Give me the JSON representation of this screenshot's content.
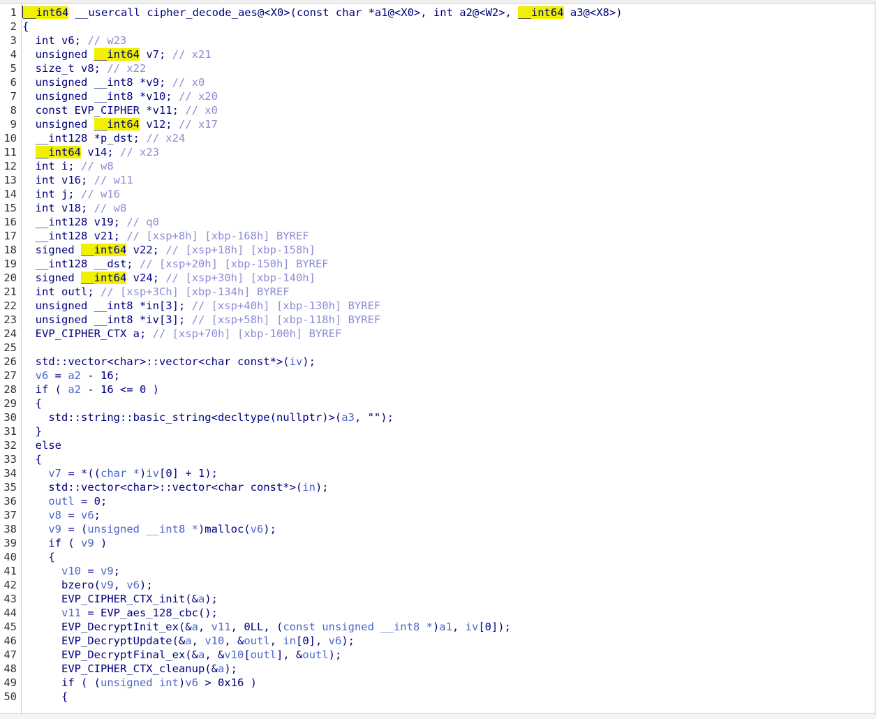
{
  "app": {
    "view": "pseudocode",
    "highlight_color": "#f0f000",
    "highlight_token": "__int64"
  },
  "colors": {
    "type": "#000080",
    "variable": "#4a66cc",
    "comment": "#8c8cd6",
    "line_number": "#333333"
  },
  "lines": [
    {
      "n": "1",
      "t": [
        [
          "hl",
          "__int64"
        ],
        [
          "t",
          " __usercall cipher_decode_aes@<X0>(const char *a1@<X0>, int a2@<W2>, "
        ],
        [
          "hl",
          "__int64"
        ],
        [
          "t",
          " a3@<X8>)"
        ]
      ]
    },
    {
      "n": "2",
      "t": [
        [
          "t",
          "{"
        ]
      ]
    },
    {
      "n": "3",
      "t": [
        [
          "t",
          "  int v6; "
        ],
        [
          "c",
          "// w23"
        ]
      ]
    },
    {
      "n": "4",
      "t": [
        [
          "t",
          "  unsigned "
        ],
        [
          "hl",
          "__int64"
        ],
        [
          "t",
          " v7; "
        ],
        [
          "c",
          "// x21"
        ]
      ]
    },
    {
      "n": "5",
      "t": [
        [
          "t",
          "  size_t v8; "
        ],
        [
          "c",
          "// x22"
        ]
      ]
    },
    {
      "n": "6",
      "t": [
        [
          "t",
          "  unsigned __int8 *v9; "
        ],
        [
          "c",
          "// x0"
        ]
      ]
    },
    {
      "n": "7",
      "t": [
        [
          "t",
          "  unsigned __int8 *v10; "
        ],
        [
          "c",
          "// x20"
        ]
      ]
    },
    {
      "n": "8",
      "t": [
        [
          "t",
          "  const EVP_CIPHER *v11; "
        ],
        [
          "c",
          "// x0"
        ]
      ]
    },
    {
      "n": "9",
      "t": [
        [
          "t",
          "  unsigned "
        ],
        [
          "hl",
          "__int64"
        ],
        [
          "t",
          " v12; "
        ],
        [
          "c",
          "// x17"
        ]
      ]
    },
    {
      "n": "10",
      "t": [
        [
          "t",
          "  __int128 *p_dst; "
        ],
        [
          "c",
          "// x24"
        ]
      ]
    },
    {
      "n": "11",
      "t": [
        [
          "t",
          "  "
        ],
        [
          "hl",
          "__int64"
        ],
        [
          "t",
          " v14; "
        ],
        [
          "c",
          "// x23"
        ]
      ]
    },
    {
      "n": "12",
      "t": [
        [
          "t",
          "  int i; "
        ],
        [
          "c",
          "// w8"
        ]
      ]
    },
    {
      "n": "13",
      "t": [
        [
          "t",
          "  int v16; "
        ],
        [
          "c",
          "// w11"
        ]
      ]
    },
    {
      "n": "14",
      "t": [
        [
          "t",
          "  int j; "
        ],
        [
          "c",
          "// w16"
        ]
      ]
    },
    {
      "n": "15",
      "t": [
        [
          "t",
          "  int v18; "
        ],
        [
          "c",
          "// w8"
        ]
      ]
    },
    {
      "n": "16",
      "t": [
        [
          "t",
          "  __int128 v19; "
        ],
        [
          "c",
          "// q0"
        ]
      ]
    },
    {
      "n": "17",
      "t": [
        [
          "t",
          "  __int128 v21; "
        ],
        [
          "c",
          "// [xsp+8h] [xbp-168h] BYREF"
        ]
      ]
    },
    {
      "n": "18",
      "t": [
        [
          "t",
          "  signed "
        ],
        [
          "hl",
          "__int64"
        ],
        [
          "t",
          " v22; "
        ],
        [
          "c",
          "// [xsp+18h] [xbp-158h]"
        ]
      ]
    },
    {
      "n": "19",
      "t": [
        [
          "t",
          "  __int128 __dst; "
        ],
        [
          "c",
          "// [xsp+20h] [xbp-150h] BYREF"
        ]
      ]
    },
    {
      "n": "20",
      "t": [
        [
          "t",
          "  signed "
        ],
        [
          "hl",
          "__int64"
        ],
        [
          "t",
          " v24; "
        ],
        [
          "c",
          "// [xsp+30h] [xbp-140h]"
        ]
      ]
    },
    {
      "n": "21",
      "t": [
        [
          "t",
          "  int outl; "
        ],
        [
          "c",
          "// [xsp+3Ch] [xbp-134h] BYREF"
        ]
      ]
    },
    {
      "n": "22",
      "t": [
        [
          "t",
          "  unsigned __int8 *in[3]; "
        ],
        [
          "c",
          "// [xsp+40h] [xbp-130h] BYREF"
        ]
      ]
    },
    {
      "n": "23",
      "t": [
        [
          "t",
          "  unsigned __int8 *iv[3]; "
        ],
        [
          "c",
          "// [xsp+58h] [xbp-118h] BYREF"
        ]
      ]
    },
    {
      "n": "24",
      "t": [
        [
          "t",
          "  EVP_CIPHER_CTX a; "
        ],
        [
          "c",
          "// [xsp+70h] [xbp-100h] BYREF"
        ]
      ]
    },
    {
      "n": "25",
      "t": []
    },
    {
      "n": "26",
      "t": [
        [
          "t",
          "  std::vector<char>::vector<char const*>("
        ],
        [
          "v",
          "iv"
        ],
        [
          "t",
          ");"
        ]
      ]
    },
    {
      "n": "27",
      "t": [
        [
          "t",
          "  "
        ],
        [
          "v",
          "v6"
        ],
        [
          "t",
          " = "
        ],
        [
          "v",
          "a2"
        ],
        [
          "t",
          " - 16;"
        ]
      ]
    },
    {
      "n": "28",
      "t": [
        [
          "t",
          "  if ( "
        ],
        [
          "v",
          "a2"
        ],
        [
          "t",
          " - 16 <= 0 )"
        ]
      ]
    },
    {
      "n": "29",
      "t": [
        [
          "t",
          "  {"
        ]
      ]
    },
    {
      "n": "30",
      "t": [
        [
          "t",
          "    std::string::basic_string<decltype(nullptr)>("
        ],
        [
          "v",
          "a3"
        ],
        [
          "t",
          ", \"\");"
        ]
      ]
    },
    {
      "n": "31",
      "t": [
        [
          "t",
          "  }"
        ]
      ]
    },
    {
      "n": "32",
      "t": [
        [
          "t",
          "  else"
        ]
      ]
    },
    {
      "n": "33",
      "t": [
        [
          "t",
          "  {"
        ]
      ]
    },
    {
      "n": "34",
      "t": [
        [
          "t",
          "    "
        ],
        [
          "v",
          "v7"
        ],
        [
          "t",
          " = *(("
        ],
        [
          "v",
          "char *"
        ],
        [
          "t",
          ")"
        ],
        [
          "v",
          "iv"
        ],
        [
          "t",
          "[0] + 1);"
        ]
      ]
    },
    {
      "n": "35",
      "t": [
        [
          "t",
          "    std::vector<char>::vector<char const*>("
        ],
        [
          "v",
          "in"
        ],
        [
          "t",
          ");"
        ]
      ]
    },
    {
      "n": "36",
      "t": [
        [
          "t",
          "    "
        ],
        [
          "v",
          "outl"
        ],
        [
          "t",
          " = 0;"
        ]
      ]
    },
    {
      "n": "37",
      "t": [
        [
          "t",
          "    "
        ],
        [
          "v",
          "v8"
        ],
        [
          "t",
          " = "
        ],
        [
          "v",
          "v6"
        ],
        [
          "t",
          ";"
        ]
      ]
    },
    {
      "n": "38",
      "t": [
        [
          "t",
          "    "
        ],
        [
          "v",
          "v9"
        ],
        [
          "t",
          " = ("
        ],
        [
          "v",
          "unsigned __int8 *"
        ],
        [
          "t",
          ")malloc("
        ],
        [
          "v",
          "v6"
        ],
        [
          "t",
          ");"
        ]
      ]
    },
    {
      "n": "39",
      "t": [
        [
          "t",
          "    if ( "
        ],
        [
          "v",
          "v9"
        ],
        [
          "t",
          " )"
        ]
      ]
    },
    {
      "n": "40",
      "t": [
        [
          "t",
          "    {"
        ]
      ]
    },
    {
      "n": "41",
      "t": [
        [
          "t",
          "      "
        ],
        [
          "v",
          "v10"
        ],
        [
          "t",
          " = "
        ],
        [
          "v",
          "v9"
        ],
        [
          "t",
          ";"
        ]
      ]
    },
    {
      "n": "42",
      "t": [
        [
          "t",
          "      bzero("
        ],
        [
          "v",
          "v9"
        ],
        [
          "t",
          ", "
        ],
        [
          "v",
          "v6"
        ],
        [
          "t",
          ");"
        ]
      ]
    },
    {
      "n": "43",
      "t": [
        [
          "t",
          "      EVP_CIPHER_CTX_init(&"
        ],
        [
          "v",
          "a"
        ],
        [
          "t",
          ");"
        ]
      ]
    },
    {
      "n": "44",
      "t": [
        [
          "t",
          "      "
        ],
        [
          "v",
          "v11"
        ],
        [
          "t",
          " = EVP_aes_128_cbc();"
        ]
      ]
    },
    {
      "n": "45",
      "t": [
        [
          "t",
          "      EVP_DecryptInit_ex(&"
        ],
        [
          "v",
          "a"
        ],
        [
          "t",
          ", "
        ],
        [
          "v",
          "v11"
        ],
        [
          "t",
          ", 0LL, ("
        ],
        [
          "v",
          "const unsigned __int8 *"
        ],
        [
          "t",
          ")"
        ],
        [
          "v",
          "a1"
        ],
        [
          "t",
          ", "
        ],
        [
          "v",
          "iv"
        ],
        [
          "t",
          "[0]);"
        ]
      ]
    },
    {
      "n": "46",
      "t": [
        [
          "t",
          "      EVP_DecryptUpdate(&"
        ],
        [
          "v",
          "a"
        ],
        [
          "t",
          ", "
        ],
        [
          "v",
          "v10"
        ],
        [
          "t",
          ", &"
        ],
        [
          "v",
          "outl"
        ],
        [
          "t",
          ", "
        ],
        [
          "v",
          "in"
        ],
        [
          "t",
          "[0], "
        ],
        [
          "v",
          "v6"
        ],
        [
          "t",
          ");"
        ]
      ]
    },
    {
      "n": "47",
      "t": [
        [
          "t",
          "      EVP_DecryptFinal_ex(&"
        ],
        [
          "v",
          "a"
        ],
        [
          "t",
          ", &"
        ],
        [
          "v",
          "v10"
        ],
        [
          "t",
          "["
        ],
        [
          "v",
          "outl"
        ],
        [
          "t",
          "], &"
        ],
        [
          "v",
          "outl"
        ],
        [
          "t",
          ");"
        ]
      ]
    },
    {
      "n": "48",
      "t": [
        [
          "t",
          "      EVP_CIPHER_CTX_cleanup(&"
        ],
        [
          "v",
          "a"
        ],
        [
          "t",
          ");"
        ]
      ]
    },
    {
      "n": "49",
      "t": [
        [
          "t",
          "      if ( ("
        ],
        [
          "v",
          "unsigned int"
        ],
        [
          "t",
          ")"
        ],
        [
          "v",
          "v6"
        ],
        [
          "t",
          " > 0x16 )"
        ]
      ]
    },
    {
      "n": "50",
      "t": [
        [
          "t",
          "      {"
        ]
      ]
    }
  ]
}
